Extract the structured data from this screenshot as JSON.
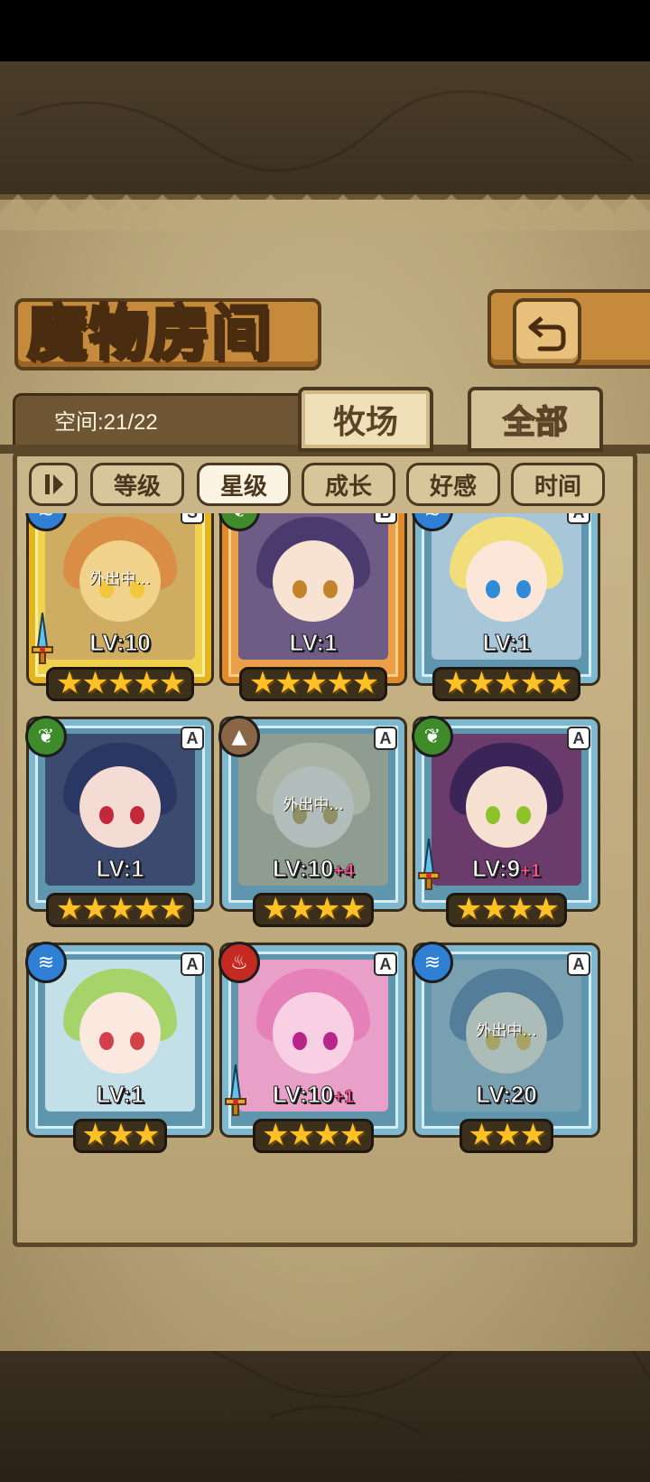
{
  "title": "魔物房间",
  "space_label": "空间:21/22",
  "tabs": [
    {
      "label": "牧场",
      "active": true
    },
    {
      "label": "全部",
      "active": false
    }
  ],
  "sort_buttons": [
    {
      "label": "等级",
      "active": false
    },
    {
      "label": "星级",
      "active": true
    },
    {
      "label": "成长",
      "active": false
    },
    {
      "label": "好感",
      "active": false
    },
    {
      "label": "时间",
      "active": false
    }
  ],
  "monsters": [
    {
      "rank": "S",
      "element": "water",
      "level": "LV:10",
      "bonus": "",
      "stars": 5,
      "status": "外出中...",
      "equipped": true,
      "frame": "gold"
    },
    {
      "rank": "B",
      "element": "nature",
      "level": "LV:1",
      "bonus": "",
      "stars": 5,
      "status": "",
      "equipped": false,
      "frame": "bronze"
    },
    {
      "rank": "A",
      "element": "water",
      "level": "LV:1",
      "bonus": "",
      "stars": 5,
      "status": "",
      "equipped": false,
      "frame": "blue"
    },
    {
      "rank": "A",
      "element": "nature",
      "level": "LV:1",
      "bonus": "",
      "stars": 5,
      "status": "",
      "equipped": false,
      "frame": "blue"
    },
    {
      "rank": "A",
      "element": "earth",
      "level": "LV:10",
      "bonus": "+4",
      "stars": 4,
      "status": "外出中...",
      "equipped": false,
      "frame": "blue"
    },
    {
      "rank": "A",
      "element": "nature",
      "level": "LV:9",
      "bonus": "+1",
      "stars": 4,
      "status": "",
      "equipped": true,
      "frame": "blue"
    },
    {
      "rank": "A",
      "element": "water",
      "level": "LV:1",
      "bonus": "",
      "stars": 3,
      "status": "",
      "equipped": false,
      "frame": "blue"
    },
    {
      "rank": "A",
      "element": "fire",
      "level": "LV:10",
      "bonus": "+1",
      "stars": 4,
      "status": "",
      "equipped": true,
      "frame": "blue"
    },
    {
      "rank": "A",
      "element": "water",
      "level": "LV:20",
      "bonus": "",
      "stars": 3,
      "status": "外出中...",
      "equipped": false,
      "frame": "blue"
    }
  ],
  "colors": {
    "water": "#2f7fd4",
    "nature": "#3f8a2a",
    "earth": "#8a6646",
    "fire": "#c42a22",
    "star": "#ffc126",
    "bonus": "#ff5f9a"
  }
}
